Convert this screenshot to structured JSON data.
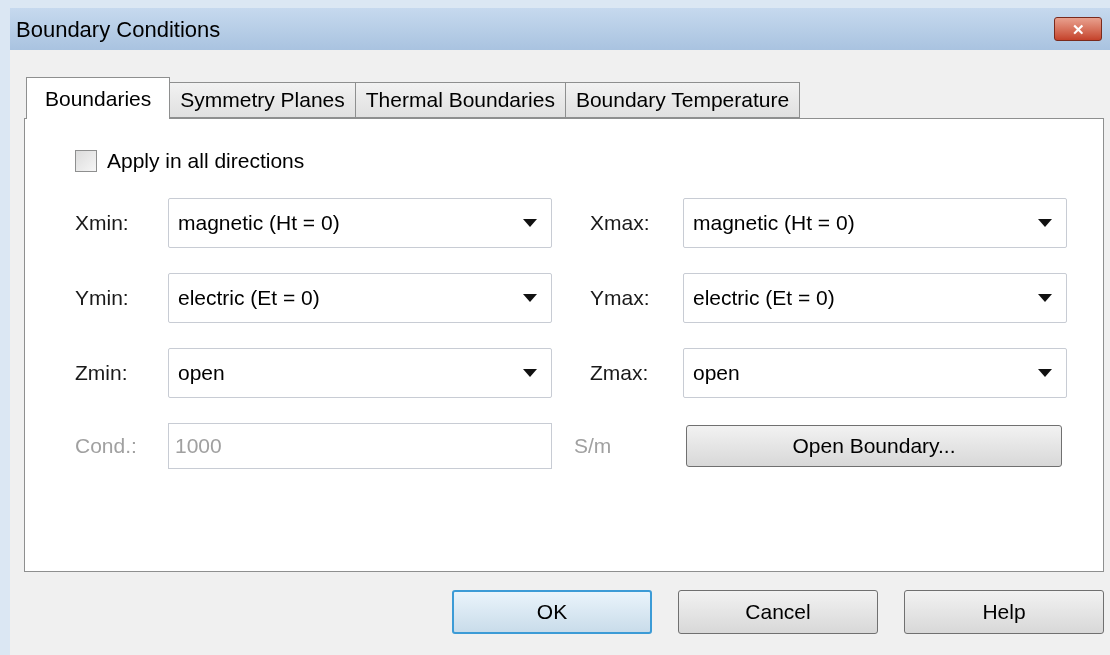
{
  "window": {
    "title": "Boundary Conditions",
    "close": "✕"
  },
  "tabs": [
    {
      "label": "Boundaries",
      "selected": true
    },
    {
      "label": "Symmetry Planes",
      "selected": false
    },
    {
      "label": "Thermal Boundaries",
      "selected": false
    },
    {
      "label": "Boundary Temperature",
      "selected": false
    }
  ],
  "apply_all": {
    "label": "Apply in all directions",
    "checked": false
  },
  "boundaries": [
    {
      "label": "Xmin:",
      "value": "magnetic (Ht = 0)"
    },
    {
      "label": "Xmax:",
      "value": "magnetic (Ht = 0)"
    },
    {
      "label": "Ymin:",
      "value": "electric (Et = 0)"
    },
    {
      "label": "Ymax:",
      "value": "electric (Et = 0)"
    },
    {
      "label": "Zmin:",
      "value": "open"
    },
    {
      "label": "Zmax:",
      "value": "open"
    }
  ],
  "conductivity": {
    "label": "Cond.:",
    "value": "1000",
    "unit": "S/m",
    "disabled": true
  },
  "open_boundary_button": "Open Boundary...",
  "buttons": [
    {
      "label": "OK",
      "default": true
    },
    {
      "label": "Cancel",
      "default": false
    },
    {
      "label": "Help",
      "default": false
    }
  ]
}
